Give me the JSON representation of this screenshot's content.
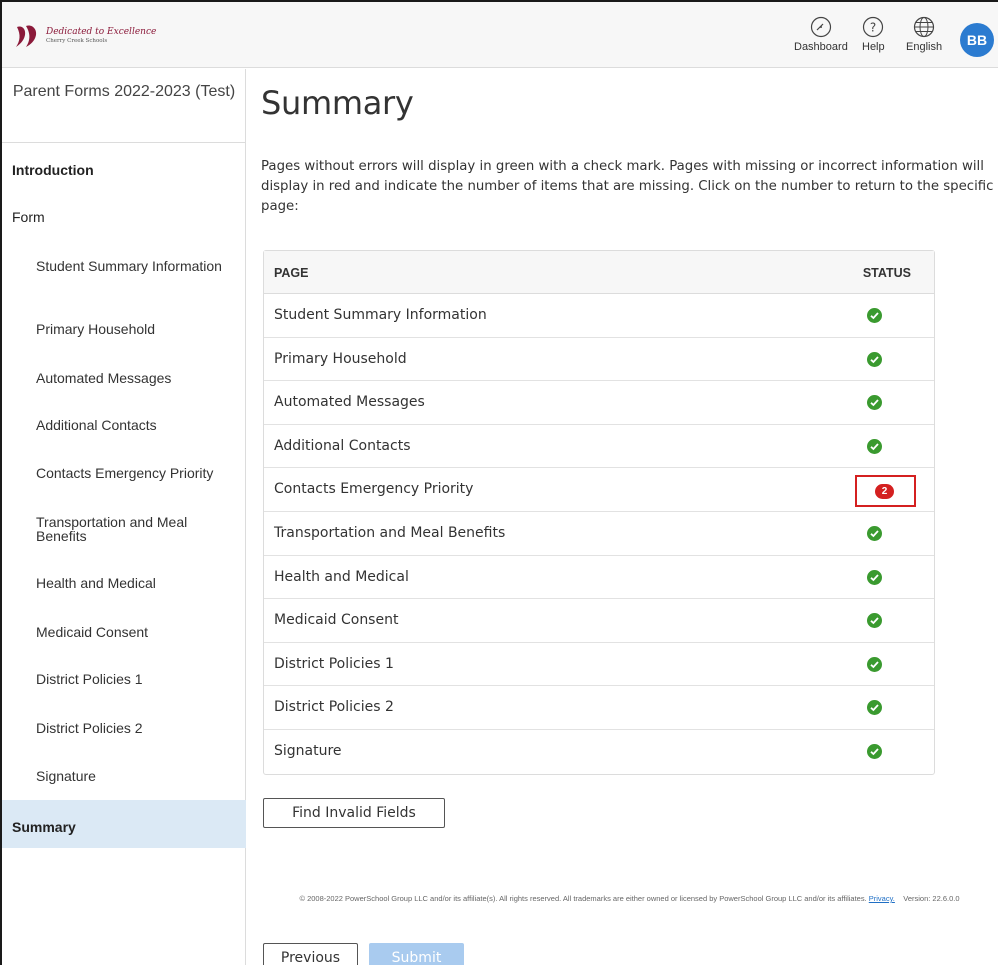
{
  "header": {
    "logo_title": "Dedicated to Excellence",
    "logo_subtitle": "Cherry Creek Schools",
    "dashboard_label": "Dashboard",
    "help_label": "Help",
    "language_label": "English",
    "avatar_initials": "BB",
    "avatar_color": "#2b7bd0"
  },
  "sidebar": {
    "title": "Parent Forms 2022-2023 (Test)",
    "intro_label": "Introduction",
    "form_label": "Form",
    "items": [
      {
        "label": "Student Summary Information"
      },
      {
        "label": "Primary Household"
      },
      {
        "label": "Automated Messages"
      },
      {
        "label": "Additional Contacts"
      },
      {
        "label": "Contacts Emergency Priority"
      },
      {
        "label": "Transportation and Meal Benefits"
      },
      {
        "label": "Health and Medical"
      },
      {
        "label": "Medicaid Consent"
      },
      {
        "label": "District Policies 1"
      },
      {
        "label": "District Policies 2"
      },
      {
        "label": "Signature"
      }
    ],
    "summary_label": "Summary"
  },
  "main": {
    "title": "Summary",
    "intro": "Pages without errors will display in green with a check mark. Pages with missing or incorrect information will display in red and indicate the number of items that are missing. Click on the number to return to the specific page:",
    "table": {
      "col_page": "PAGE",
      "col_status": "STATUS",
      "rows": [
        {
          "page": "Student Summary Information",
          "status": "ok"
        },
        {
          "page": "Primary Household",
          "status": "ok"
        },
        {
          "page": "Automated Messages",
          "status": "ok"
        },
        {
          "page": "Additional Contacts",
          "status": "ok"
        },
        {
          "page": "Contacts Emergency Priority",
          "status": "error",
          "count": "2"
        },
        {
          "page": "Transportation and Meal Benefits",
          "status": "ok"
        },
        {
          "page": "Health and Medical",
          "status": "ok"
        },
        {
          "page": "Medicaid Consent",
          "status": "ok"
        },
        {
          "page": "District Policies 1",
          "status": "ok"
        },
        {
          "page": "District Policies 2",
          "status": "ok"
        },
        {
          "page": "Signature",
          "status": "ok"
        }
      ]
    },
    "find_invalid_label": "Find Invalid Fields",
    "footer_text": "© 2008-2022 PowerSchool Group LLC and/or its affiliate(s). All rights reserved. All trademarks are either owned or licensed by PowerSchool Group LLC and/or its affiliates.",
    "footer_privacy": "Privacy.",
    "footer_version": "Version: 22.6.0.0",
    "previous_label": "Previous",
    "submit_label": "Submit"
  },
  "colors": {
    "ok_green": "#3a9a2f",
    "error_red": "#d42020",
    "active_nav": "#dbe9f5",
    "submit_disabled": "#a9cbef"
  }
}
